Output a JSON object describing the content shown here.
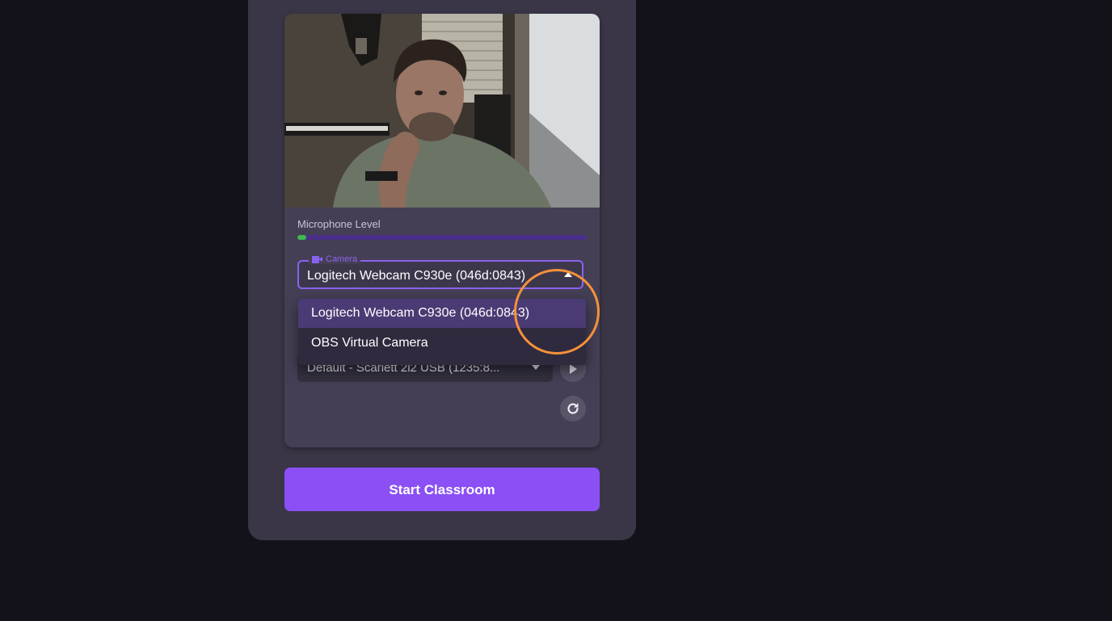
{
  "mic": {
    "label": "Microphone Level",
    "level_fraction": 0.03
  },
  "camera": {
    "legend": "Camera",
    "icon": "video-camera-icon",
    "selected": "Logitech Webcam C930e (046d:0843)",
    "options": [
      "Logitech Webcam C930e (046d:0843)",
      "OBS Virtual Camera"
    ]
  },
  "audio": {
    "selected": "Default - Scarlett 2i2 USB (1235:8..."
  },
  "actions": {
    "start_label": "Start Classroom",
    "play_icon": "play-icon",
    "refresh_icon": "refresh-icon"
  },
  "colors": {
    "accent": "#8a50f5",
    "mic_fill": "#3fb950",
    "highlight": "#f5913a"
  }
}
